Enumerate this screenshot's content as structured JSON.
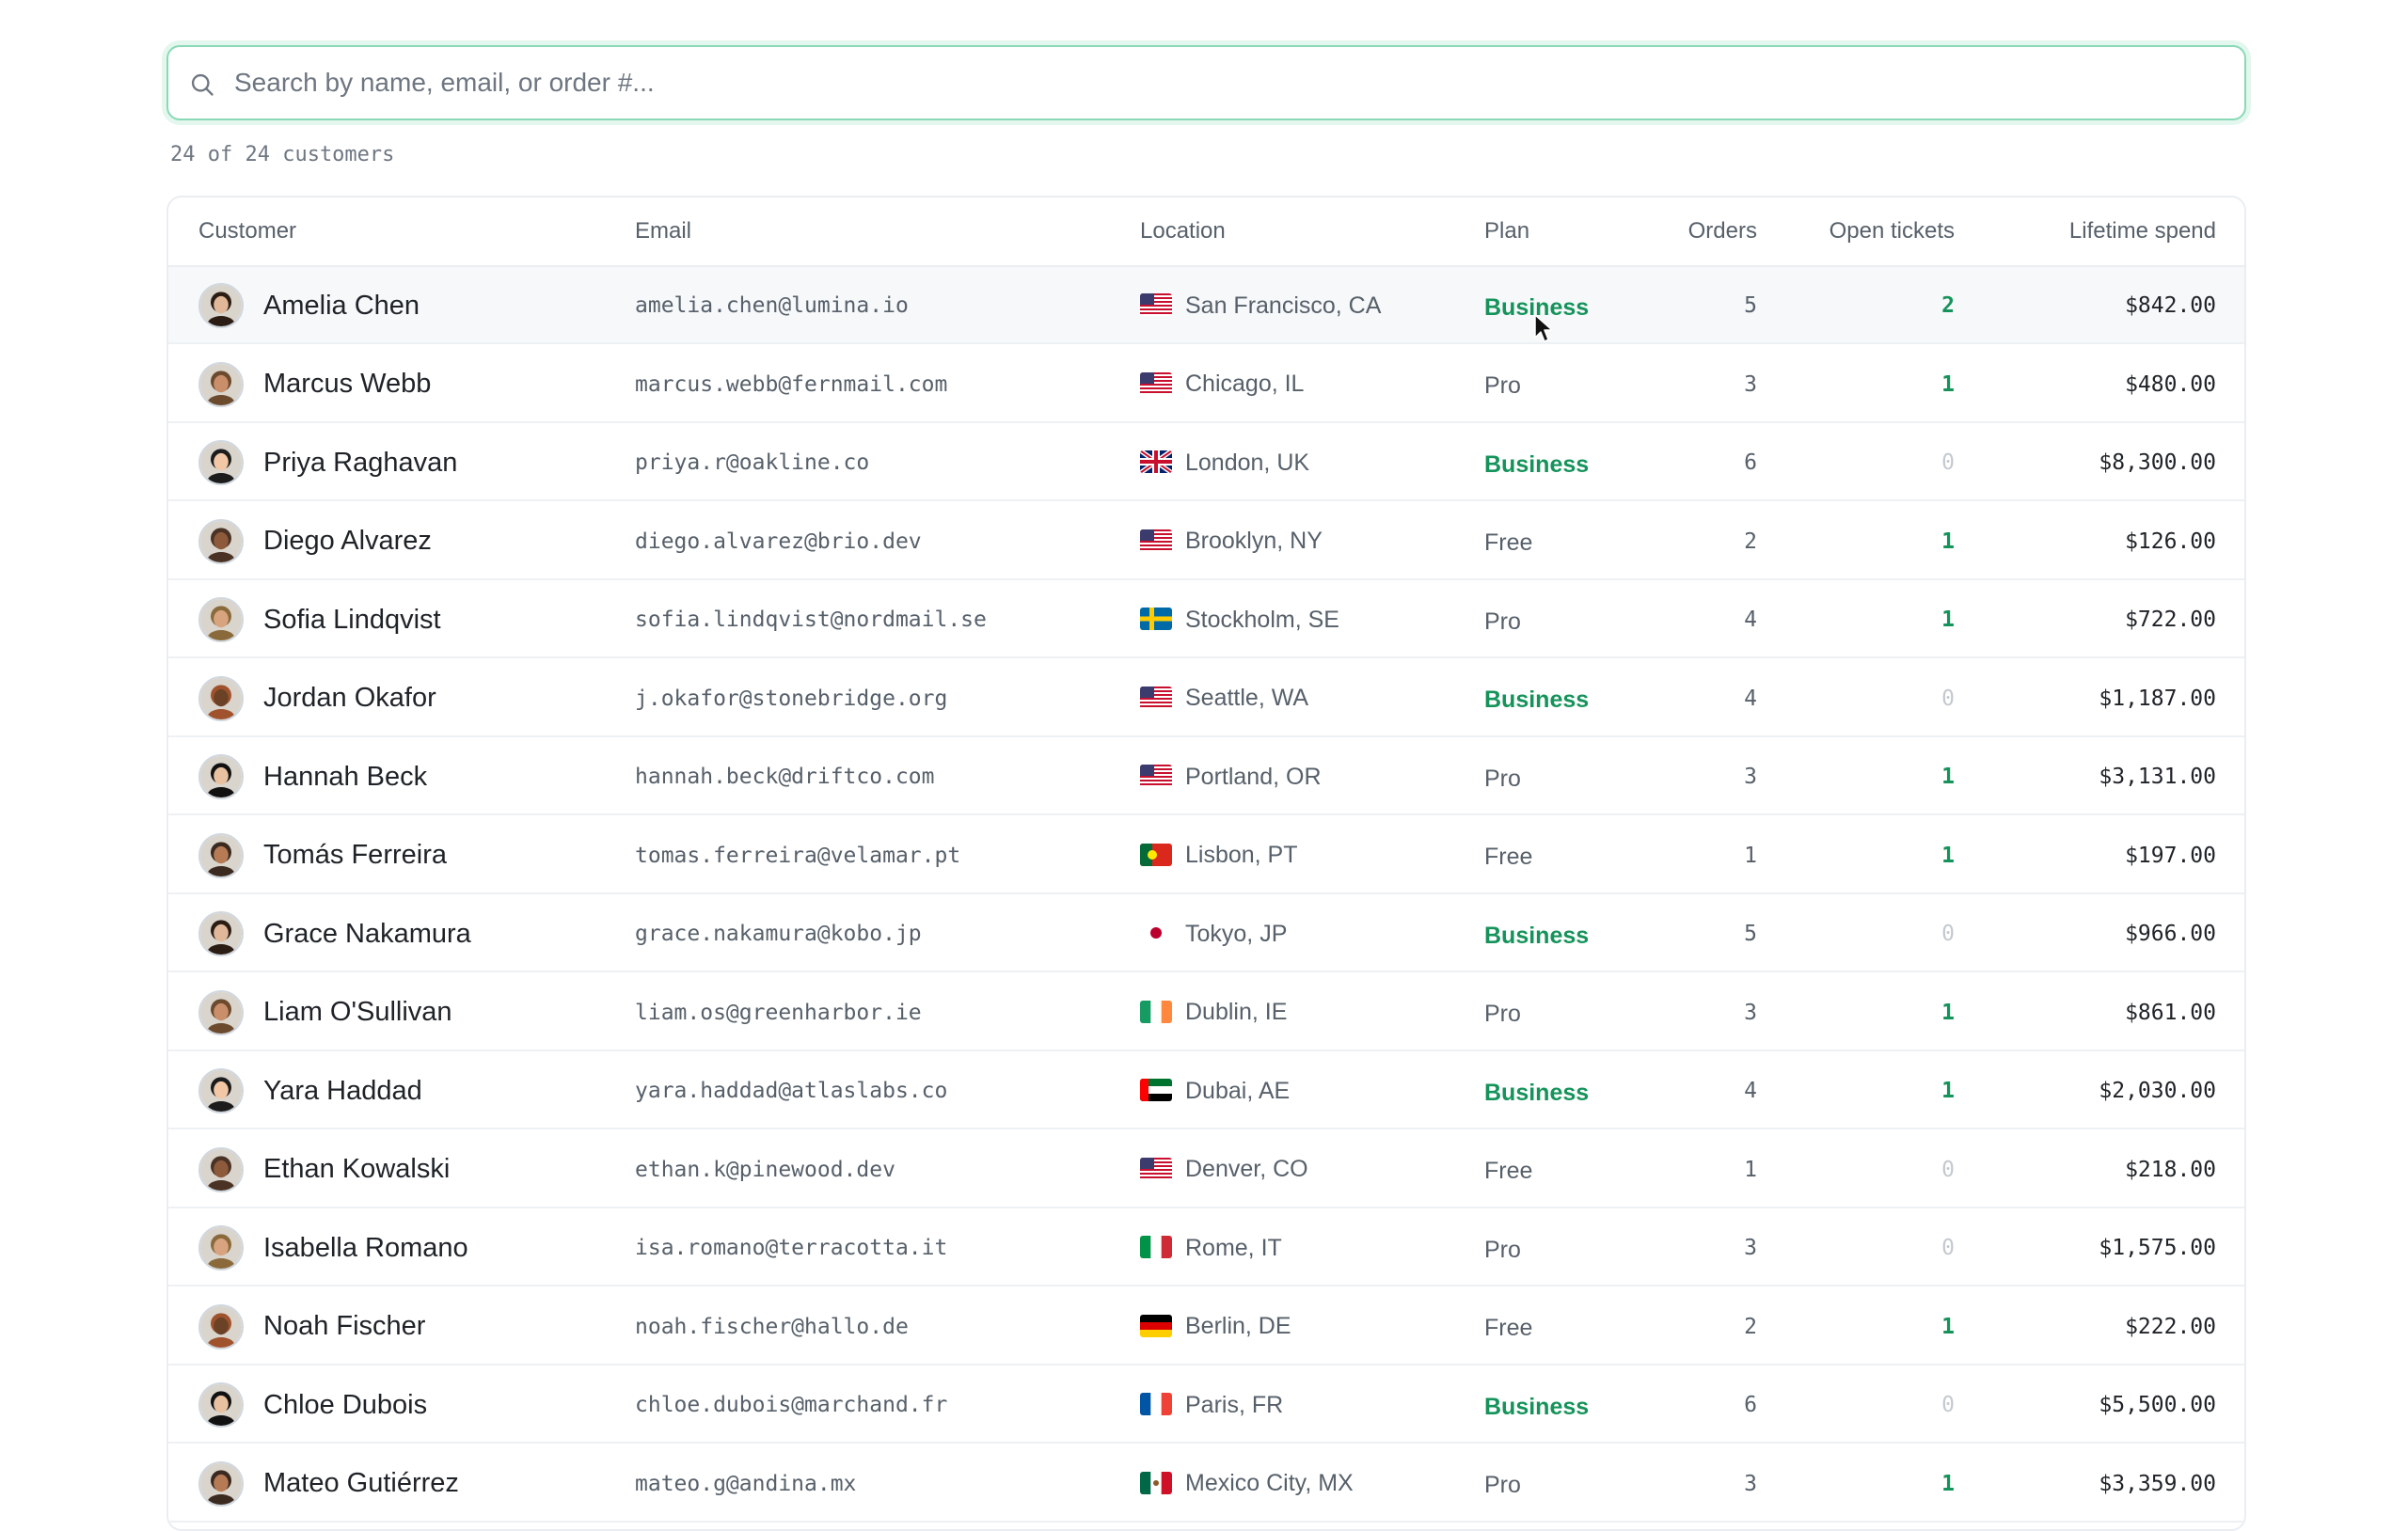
{
  "search": {
    "placeholder": "Search by name, email, or order #..."
  },
  "summary": "24 of 24 customers",
  "table": {
    "headers": {
      "customer": "Customer",
      "email": "Email",
      "location": "Location",
      "plan": "Plan",
      "orders": "Orders",
      "tickets": "Open tickets",
      "spend": "Lifetime spend"
    },
    "rows": [
      {
        "name": "Amelia Chen",
        "email": "amelia.chen@lumina.io",
        "flag": "us",
        "location": "San Francisco, CA",
        "plan": "Business",
        "orders": "5",
        "tickets": "2",
        "spend": "$842.00"
      },
      {
        "name": "Marcus Webb",
        "email": "marcus.webb@fernmail.com",
        "flag": "us",
        "location": "Chicago, IL",
        "plan": "Pro",
        "orders": "3",
        "tickets": "1",
        "spend": "$480.00"
      },
      {
        "name": "Priya Raghavan",
        "email": "priya.r@oakline.co",
        "flag": "gb",
        "location": "London, UK",
        "plan": "Business",
        "orders": "6",
        "tickets": "0",
        "spend": "$8,300.00"
      },
      {
        "name": "Diego Alvarez",
        "email": "diego.alvarez@brio.dev",
        "flag": "us",
        "location": "Brooklyn, NY",
        "plan": "Free",
        "orders": "2",
        "tickets": "1",
        "spend": "$126.00"
      },
      {
        "name": "Sofia Lindqvist",
        "email": "sofia.lindqvist@nordmail.se",
        "flag": "se",
        "location": "Stockholm, SE",
        "plan": "Pro",
        "orders": "4",
        "tickets": "1",
        "spend": "$722.00"
      },
      {
        "name": "Jordan Okafor",
        "email": "j.okafor@stonebridge.org",
        "flag": "us",
        "location": "Seattle, WA",
        "plan": "Business",
        "orders": "4",
        "tickets": "0",
        "spend": "$1,187.00"
      },
      {
        "name": "Hannah Beck",
        "email": "hannah.beck@driftco.com",
        "flag": "us",
        "location": "Portland, OR",
        "plan": "Pro",
        "orders": "3",
        "tickets": "1",
        "spend": "$3,131.00"
      },
      {
        "name": "Tomás Ferreira",
        "email": "tomas.ferreira@velamar.pt",
        "flag": "pt",
        "location": "Lisbon, PT",
        "plan": "Free",
        "orders": "1",
        "tickets": "1",
        "spend": "$197.00"
      },
      {
        "name": "Grace Nakamura",
        "email": "grace.nakamura@kobo.jp",
        "flag": "jp",
        "location": "Tokyo, JP",
        "plan": "Business",
        "orders": "5",
        "tickets": "0",
        "spend": "$966.00"
      },
      {
        "name": "Liam O'Sullivan",
        "email": "liam.os@greenharbor.ie",
        "flag": "ie",
        "location": "Dublin, IE",
        "plan": "Pro",
        "orders": "3",
        "tickets": "1",
        "spend": "$861.00"
      },
      {
        "name": "Yara Haddad",
        "email": "yara.haddad@atlaslabs.co",
        "flag": "ae",
        "location": "Dubai, AE",
        "plan": "Business",
        "orders": "4",
        "tickets": "1",
        "spend": "$2,030.00"
      },
      {
        "name": "Ethan Kowalski",
        "email": "ethan.k@pinewood.dev",
        "flag": "us",
        "location": "Denver, CO",
        "plan": "Free",
        "orders": "1",
        "tickets": "0",
        "spend": "$218.00"
      },
      {
        "name": "Isabella Romano",
        "email": "isa.romano@terracotta.it",
        "flag": "it",
        "location": "Rome, IT",
        "plan": "Pro",
        "orders": "3",
        "tickets": "0",
        "spend": "$1,575.00"
      },
      {
        "name": "Noah Fischer",
        "email": "noah.fischer@hallo.de",
        "flag": "de",
        "location": "Berlin, DE",
        "plan": "Free",
        "orders": "2",
        "tickets": "1",
        "spend": "$222.00"
      },
      {
        "name": "Chloe Dubois",
        "email": "chloe.dubois@marchand.fr",
        "flag": "fr",
        "location": "Paris, FR",
        "plan": "Business",
        "orders": "6",
        "tickets": "0",
        "spend": "$5,500.00"
      },
      {
        "name": "Mateo Gutiérrez",
        "email": "mateo.g@andina.mx",
        "flag": "mx",
        "location": "Mexico City, MX",
        "plan": "Pro",
        "orders": "3",
        "tickets": "1",
        "spend": "$3,359.00"
      }
    ]
  },
  "colors": {
    "accent_green": "#15935a",
    "search_focus": "#8ad9b6",
    "muted_text": "#57606a",
    "row_hover": "#f6f8fa"
  },
  "icons": {
    "search": "search-icon",
    "cursor": "mouse-pointer-icon"
  }
}
